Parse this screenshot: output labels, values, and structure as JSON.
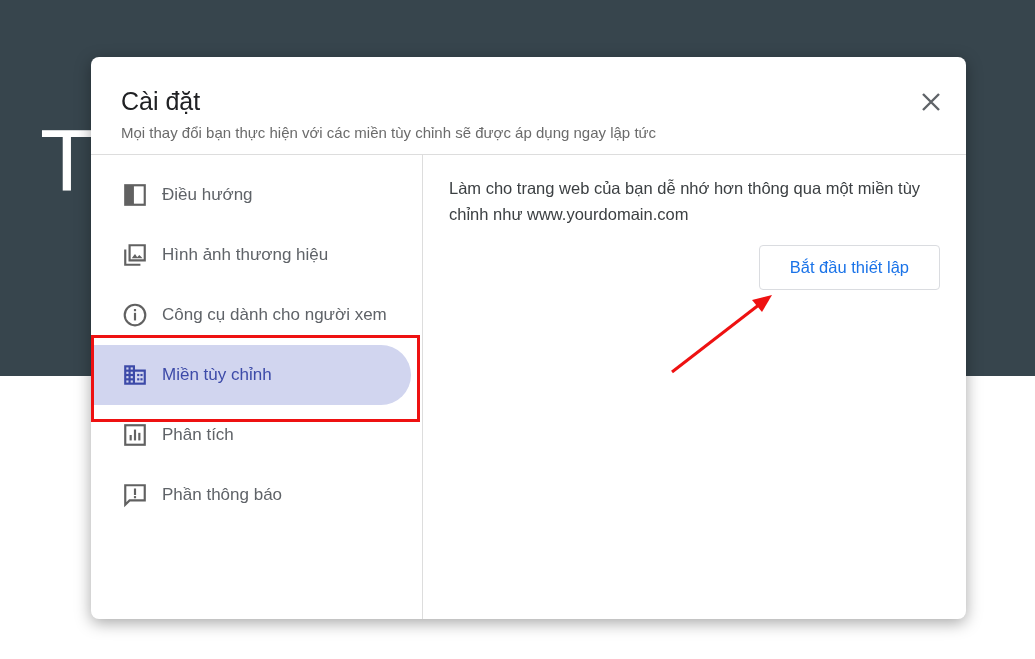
{
  "background": {
    "heading": "T"
  },
  "dialog": {
    "title": "Cài đặt",
    "subtitle": "Mọi thay đổi bạn thực hiện với các miền tùy chỉnh sẽ được áp dụng ngay lập tức"
  },
  "sidebar": {
    "items": [
      {
        "kind": "navigation",
        "label": "Điều hướng",
        "selected": false
      },
      {
        "kind": "image",
        "label": "Hình ảnh thương hiệu",
        "selected": false
      },
      {
        "kind": "info",
        "label": "Công cụ dành cho người xem",
        "selected": false
      },
      {
        "kind": "domain",
        "label": "Miền tùy chỉnh",
        "selected": true
      },
      {
        "kind": "analytics",
        "label": "Phân tích",
        "selected": false
      },
      {
        "kind": "feedback",
        "label": "Phần thông báo",
        "selected": false
      }
    ]
  },
  "content": {
    "description": "Làm cho trang web của bạn dễ nhớ hơn thông qua một miền tùy chỉnh như www.yourdomain.com",
    "button": "Bắt đầu thiết lập"
  }
}
